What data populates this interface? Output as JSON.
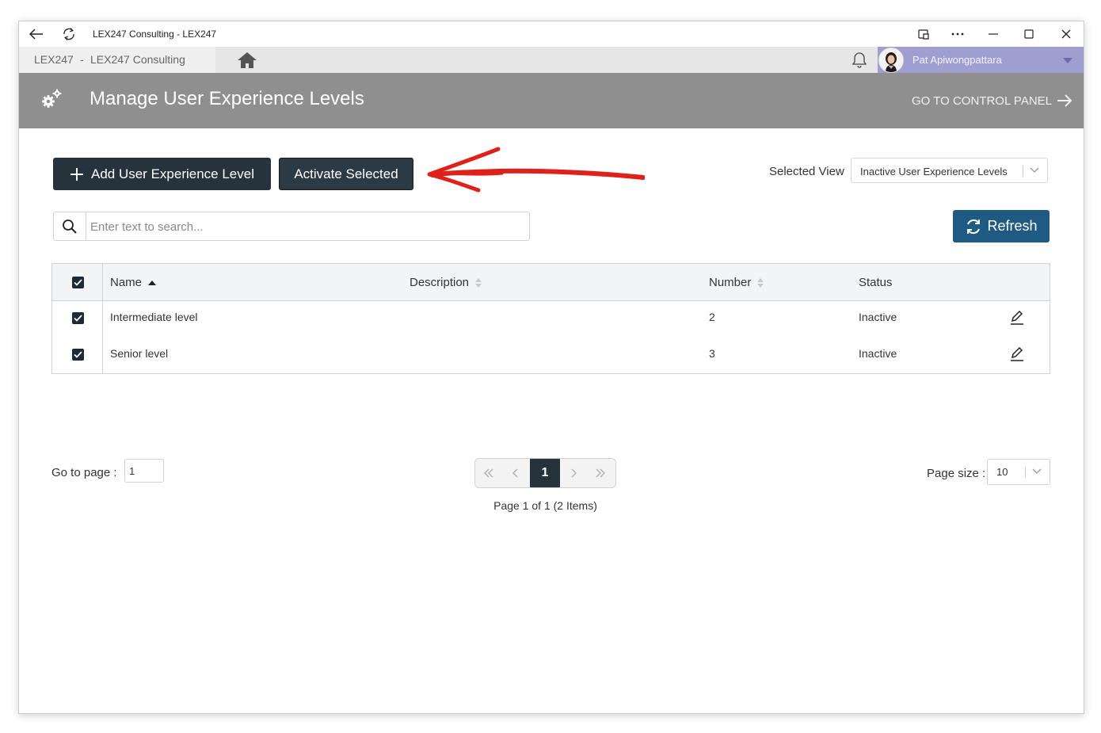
{
  "window": {
    "title": "LEX247 Consulting - LEX247"
  },
  "tabbar": {
    "app_name": "LEX247",
    "separator": "-",
    "firm_name": "LEX247 Consulting",
    "user_name": "Pat Apiwongpattara"
  },
  "header": {
    "title": "Manage User Experience Levels",
    "control_panel_link": "GO TO CONTROL PANEL"
  },
  "toolbar": {
    "add_label": "Add User Experience Level",
    "activate_label": "Activate Selected",
    "selected_view_label": "Selected View",
    "selected_view_value": "Inactive User Experience Levels",
    "refresh_label": "Refresh"
  },
  "search": {
    "placeholder": "Enter text to search...",
    "value": ""
  },
  "table": {
    "columns": [
      "Name",
      "Description",
      "Number",
      "Status"
    ],
    "rows": [
      {
        "name": "Intermediate level",
        "description": "",
        "number": "2",
        "status": "Inactive",
        "checked": true
      },
      {
        "name": "Senior level",
        "description": "",
        "number": "3",
        "status": "Inactive",
        "checked": true
      }
    ]
  },
  "pagination": {
    "goto_label": "Go to page :",
    "goto_value": "1",
    "current_page": "1",
    "info": "Page 1 of 1 (2 Items)",
    "page_size_label": "Page size :",
    "page_size_value": "10"
  },
  "colors": {
    "header_bg": "#8f8f8f",
    "dark_button": "#26323c",
    "refresh_button": "#1f5a82",
    "user_bar": "#9e9ed0",
    "annotation_arrow": "#e0201b"
  }
}
